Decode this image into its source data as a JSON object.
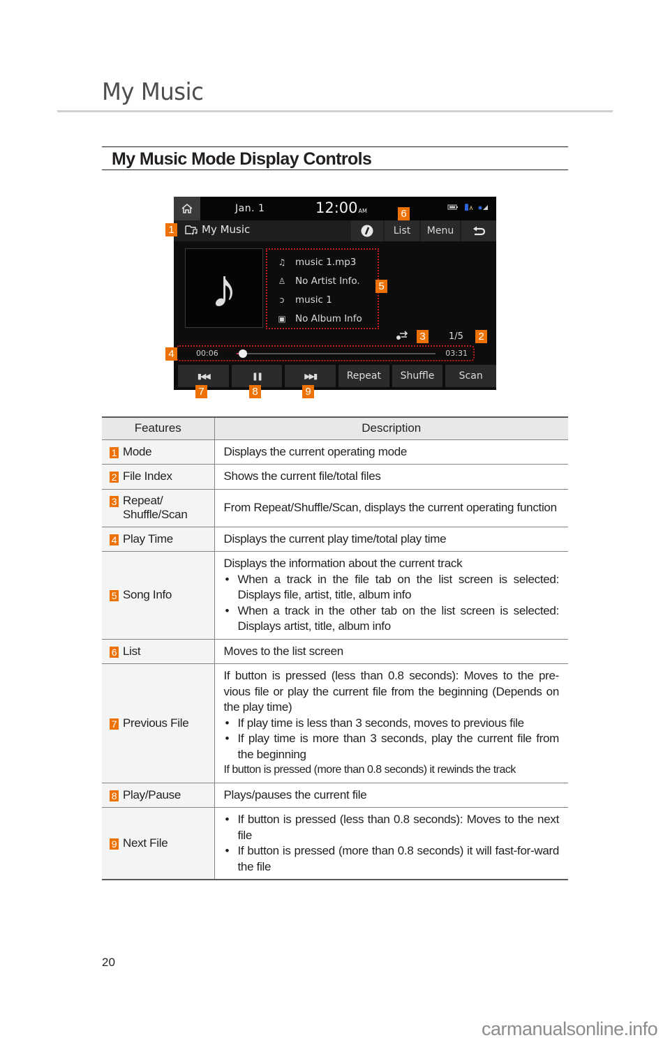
{
  "page": {
    "chapter_title": "My Music",
    "section_title": "My Music Mode Display Controls",
    "page_number": "20",
    "watermark": "carmanualsonline.info"
  },
  "colors": {
    "callout": "#ee7203",
    "highlight_dotted": "#c81a1a",
    "screen_bg": "#0d0d0d"
  },
  "screen": {
    "status": {
      "home_icon": "home-icon",
      "date": "Jan.  1",
      "time": "12:00",
      "ampm": "AM",
      "icons": [
        "battery-icon",
        "bluetooth-icon",
        "signal-icon"
      ]
    },
    "mode": {
      "icon": "folder-music-icon",
      "label": "My Music"
    },
    "top_buttons": [
      {
        "icon": "sound-icon",
        "label": ""
      },
      {
        "label": "List"
      },
      {
        "label": "Menu"
      },
      {
        "icon": "back-icon",
        "label": ""
      }
    ],
    "album_art_icon": "music-note-icon",
    "song_info": [
      {
        "icon": "file-music-icon",
        "text": "music 1.mp3"
      },
      {
        "icon": "artist-icon",
        "text": "No Artist Info."
      },
      {
        "icon": "title-icon",
        "text": "music 1"
      },
      {
        "icon": "album-icon",
        "text": "No Album Info"
      }
    ],
    "mode_indicator_icon": "repeat-icon",
    "file_index": "1/5",
    "play_time": {
      "current": "00:06",
      "total": "03:31",
      "progress_fraction": 0.03
    },
    "controls": [
      {
        "name": "previous",
        "icon": "previous-icon",
        "label": "⏮"
      },
      {
        "name": "pause",
        "icon": "pause-icon",
        "label": "❚❚"
      },
      {
        "name": "next",
        "icon": "next-icon",
        "label": "⏭"
      },
      {
        "name": "repeat",
        "label": "Repeat"
      },
      {
        "name": "shuffle",
        "label": "Shuffle"
      },
      {
        "name": "scan",
        "label": "Scan"
      }
    ],
    "callouts": [
      "1",
      "2",
      "3",
      "4",
      "5",
      "6",
      "7",
      "8",
      "9"
    ]
  },
  "table": {
    "headers": [
      "Features",
      "Description"
    ],
    "rows": [
      {
        "num": "1",
        "feature": "Mode",
        "desc": "Displays the current operating mode"
      },
      {
        "num": "2",
        "feature": "File Index",
        "desc": "Shows the current file/total files"
      },
      {
        "num": "3",
        "feature": "Repeat/ Shuffle/Scan",
        "feature_line1": "Repeat/",
        "feature_line2": "Shuffle/Scan",
        "desc": "From Repeat/Shuffle/Scan, displays the current operating function"
      },
      {
        "num": "4",
        "feature": "Play Time",
        "desc": "Displays the current play time/total play time"
      },
      {
        "num": "5",
        "feature": "Song Info",
        "desc": "Displays the information about the current track",
        "bullets": [
          "When a track in the file tab on the list screen is selected: Displays file, artist, title, album info",
          "When a track in the other tab on the list screen is selected: Displays artist, title, album info"
        ]
      },
      {
        "num": "6",
        "feature": "List",
        "desc": "Moves to the list screen"
      },
      {
        "num": "7",
        "feature": "Previous File",
        "desc": "If button is pressed (less than 0.8 seconds): Moves to the pre-vious file or play the current file from the beginning (Depends on the play time)",
        "bullets": [
          "If play time is less than 3 seconds, moves to previous file",
          "If play time is more than 3 seconds, play the current file from the beginning"
        ],
        "desc_after": "If button is pressed (more than 0.8 seconds) it rewinds the track"
      },
      {
        "num": "8",
        "feature": "Play/Pause",
        "desc": "Plays/pauses the current file"
      },
      {
        "num": "9",
        "feature": "Next File",
        "bullets": [
          "If button is pressed (less than 0.8 seconds): Moves to the next file",
          "If button is pressed (more than 0.8 seconds) it will fast-for-ward the file"
        ]
      }
    ]
  }
}
